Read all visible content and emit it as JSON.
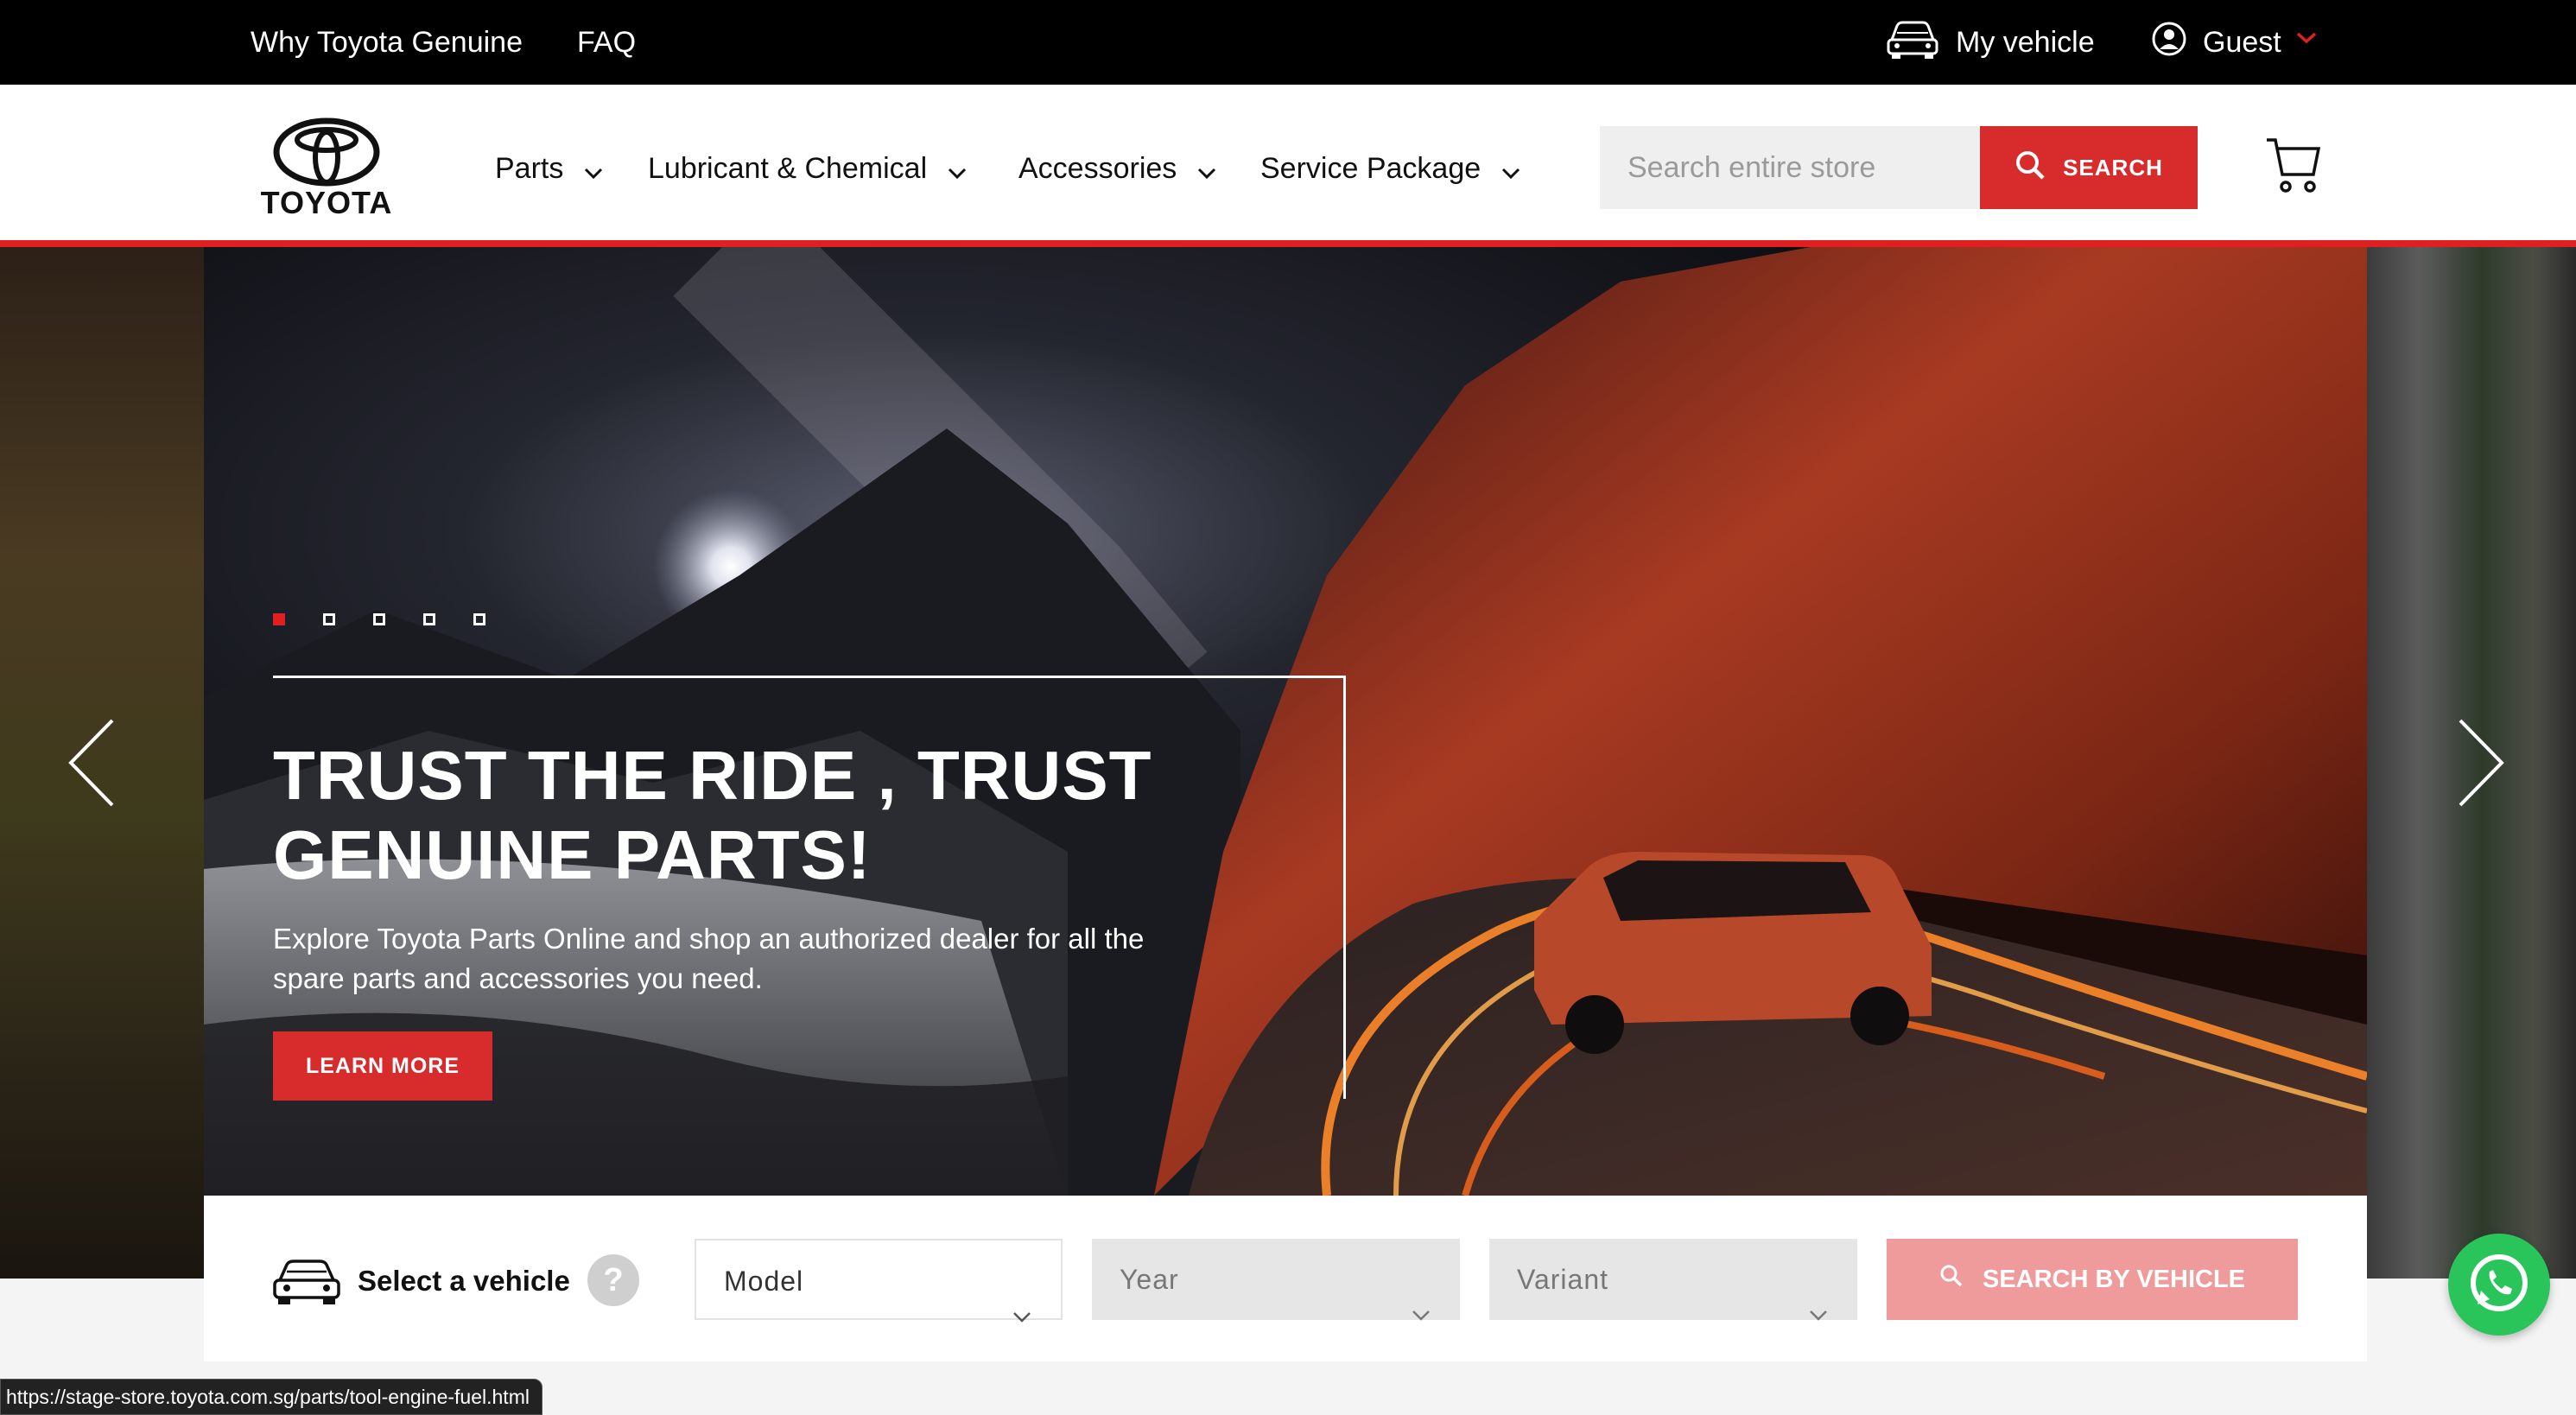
{
  "topbar": {
    "why_genuine": "Why Toyota Genuine",
    "faq": "FAQ",
    "my_vehicle": "My vehicle",
    "guest": "Guest"
  },
  "header": {
    "logo_text": "TOYOTA",
    "nav": [
      "Parts",
      "Lubricant & Chemical",
      "Accessories",
      "Service Package"
    ],
    "search_placeholder": "Search entire store",
    "search_button": "SEARCH"
  },
  "hero": {
    "slide_count": 5,
    "active_slide": 1,
    "headline_line1": "TRUST THE RIDE , TRUST",
    "headline_line2": "GENUINE PARTS!",
    "subtext": "Explore Toyota Parts Online and shop an authorized dealer for all the spare parts and accessories you need.",
    "cta": "LEARN MORE"
  },
  "vehicle_selector": {
    "title": "Select a vehicle",
    "help": "?",
    "model": "Model",
    "year": "Year",
    "variant": "Variant",
    "button": "SEARCH BY VEHICLE"
  },
  "status_url": "https://stage-store.toyota.com.sg/parts/tool-engine-fuel.html",
  "colors": {
    "brand_red": "#d82b2b",
    "topbar_bg": "#000000",
    "disabled_red": "#f09b9b",
    "whatsapp_green": "#29c45a"
  }
}
